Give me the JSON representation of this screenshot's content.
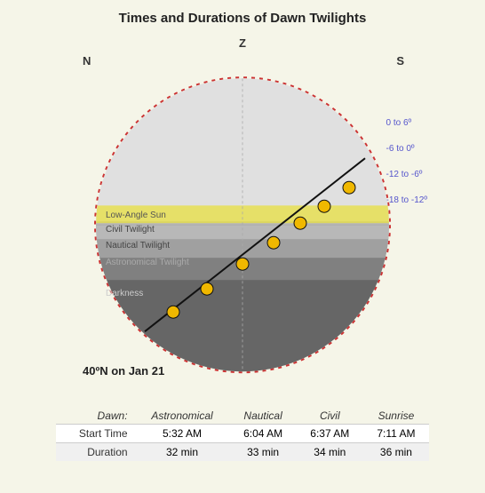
{
  "title": "Times and Durations of Dawn Twilights",
  "cardinals": {
    "N": "N",
    "S": "S",
    "Z": "Z"
  },
  "angle_labels": [
    "0 to 6º",
    "-6 to 0º",
    "-12 to -6º",
    "-18 to -12º"
  ],
  "band_labels": {
    "low_angle": "Low-Angle Sun",
    "civil": "Civil Twilight",
    "nautical": "Nautical Twilight",
    "astronomical": "Astronomical Twilight",
    "darkness": "Darkness"
  },
  "location": "40ºN on Jan 21",
  "table": {
    "headers": [
      "Dawn:",
      "Astronomical",
      "Nautical",
      "Civil",
      "Sunrise"
    ],
    "rows": [
      {
        "label": "Start Time",
        "astronomical": "5:32 AM",
        "nautical": "6:04 AM",
        "civil": "6:37 AM",
        "sunrise": "7:11 AM"
      },
      {
        "label": "Duration",
        "astronomical": "32 min",
        "nautical": "33 min",
        "civil": "34 min",
        "sunrise": "36 min"
      }
    ]
  }
}
